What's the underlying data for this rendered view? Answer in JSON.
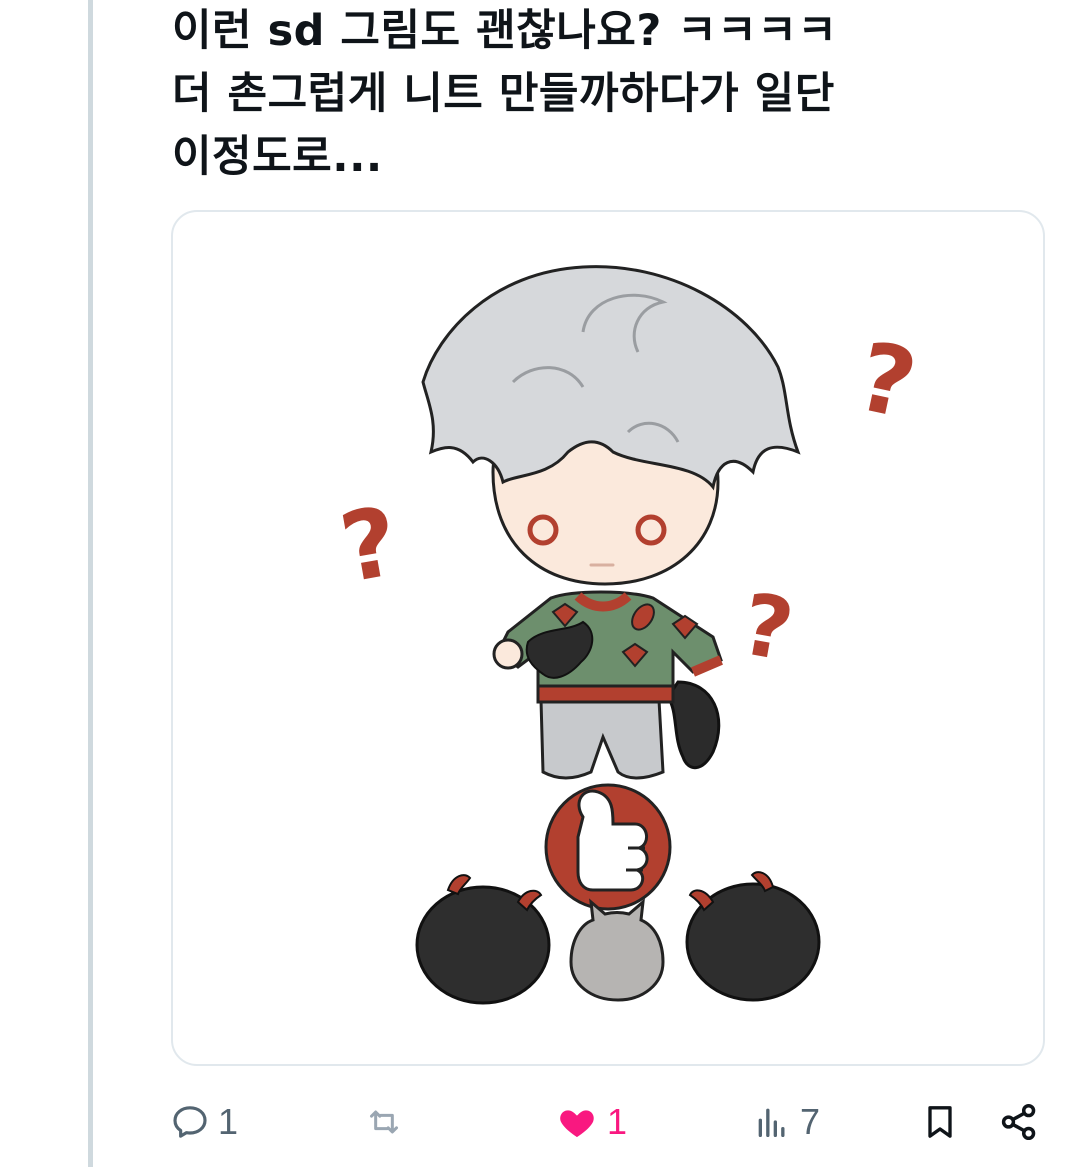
{
  "tweet": {
    "lines": [
      "이런 sd 그림도 괜찮나요? ㅋㅋㅋㅋ",
      "더 촌그럽게 니트 만들까하다가 일단",
      "이정도로..."
    ]
  },
  "media": {
    "kind": "illustration",
    "question_mark": "?"
  },
  "actions": {
    "reply": {
      "icon": "reply-icon",
      "count": "1"
    },
    "retweet": {
      "icon": "retweet-icon",
      "count": ""
    },
    "like": {
      "icon": "heart-icon",
      "count": "1",
      "liked": true
    },
    "views": {
      "icon": "views-icon",
      "count": "7"
    },
    "bookmark": {
      "icon": "bookmark-icon"
    },
    "share": {
      "icon": "share-icon"
    }
  },
  "colors": {
    "text": "#0f1419",
    "muted": "#536471",
    "like": "#f91880",
    "border": "#e1e8ed",
    "thread_line": "#cfd9de",
    "hair": "#d6d8db",
    "skin": "#fbe9dc",
    "sweater": "#6d8f6d",
    "accent_red": "#b2402f",
    "pants": "#c7c9cc",
    "blob": "#2e2e2e"
  }
}
